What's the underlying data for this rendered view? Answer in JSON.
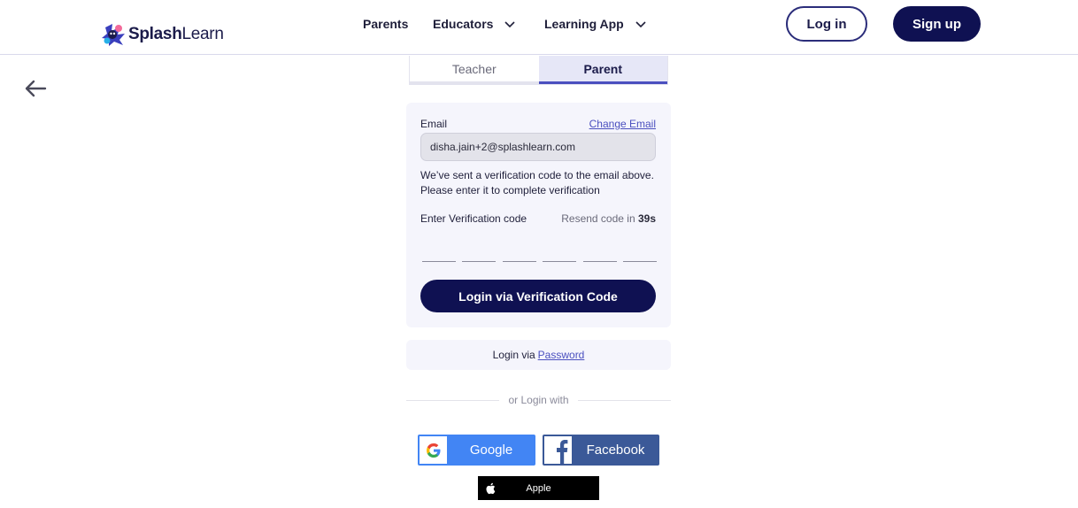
{
  "header": {
    "logo_bold": "Splash",
    "logo_light": "Learn",
    "nav": [
      {
        "label": "Parents"
      },
      {
        "label": "Educators"
      },
      {
        "label": "Learning App"
      }
    ],
    "login_label": "Log in",
    "signup_label": "Sign up"
  },
  "tabs": [
    {
      "label": "Teacher",
      "active": false
    },
    {
      "label": "Parent",
      "active": true
    }
  ],
  "card": {
    "email_label": "Email",
    "change_email": "Change Email",
    "email_value": "disha.jain+2@splashlearn.com",
    "info_line1": "We’ve sent a verification code to the email above.",
    "info_line2": "Please enter it to complete verification",
    "code_label": "Enter Verification code",
    "resend_prefix": "Resend code in",
    "resend_seconds": "39s",
    "otp_digits": 6,
    "verify_button": "Login via Verification Code"
  },
  "password_row": {
    "prefix": "Login via",
    "link": "Password"
  },
  "divider_text": "or Login with",
  "social": {
    "google": "Google",
    "facebook": "Facebook",
    "apple": "Apple"
  },
  "colors": {
    "brand_navy": "#0f1152",
    "accent": "#4a4fbf",
    "google": "#4285f4",
    "facebook": "#3b5998"
  },
  "icons": [
    "splashlearn-logo-icon",
    "chevron-down-icon",
    "back-arrow-icon",
    "google-icon",
    "facebook-icon",
    "apple-icon"
  ]
}
